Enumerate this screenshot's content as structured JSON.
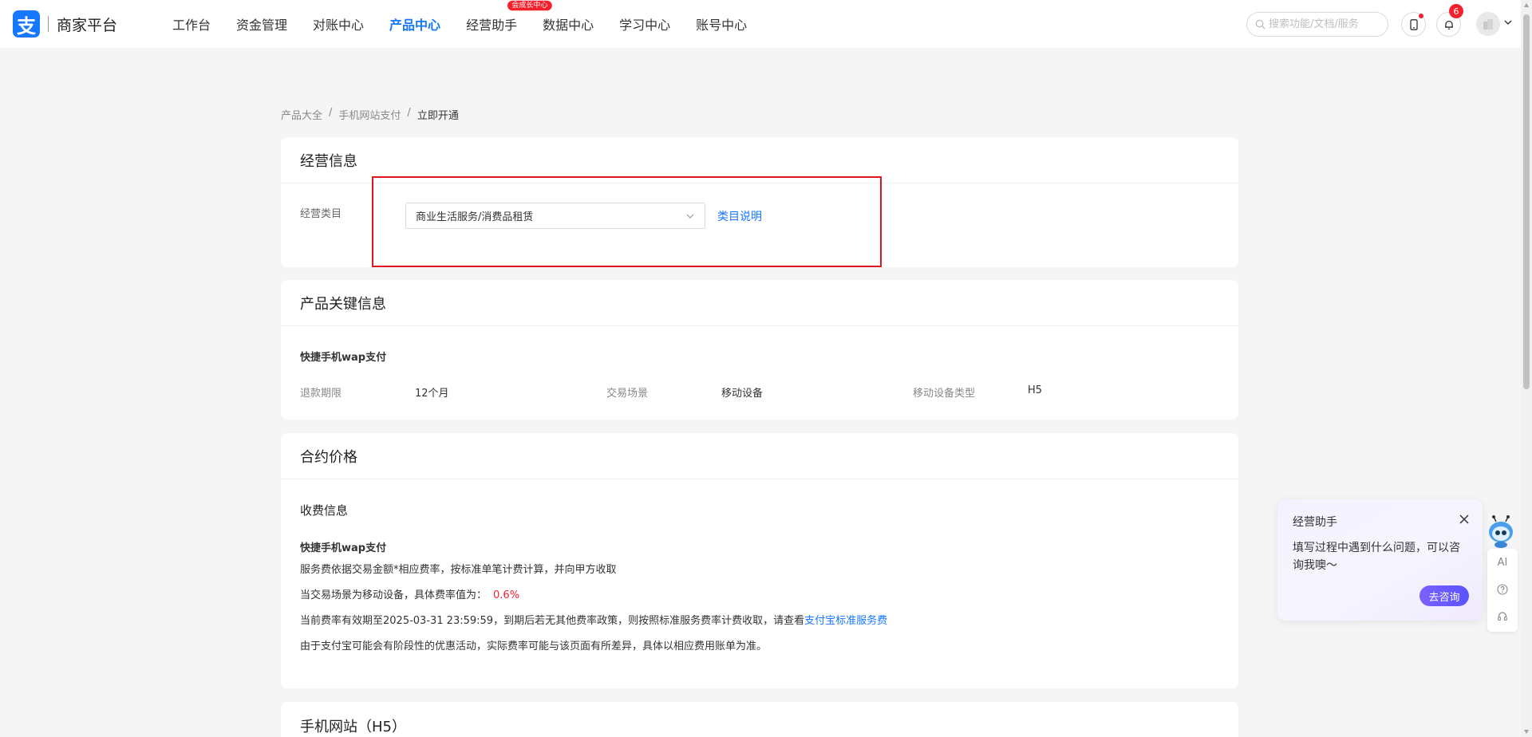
{
  "header": {
    "logo_glyph": "支",
    "app_title": "商家平台",
    "nav": [
      {
        "label": "工作台",
        "active": false
      },
      {
        "label": "资金管理",
        "active": false
      },
      {
        "label": "对账中心",
        "active": false
      },
      {
        "label": "产品中心",
        "active": true
      },
      {
        "label": "经营助手",
        "active": false,
        "badge": "会成长中心"
      },
      {
        "label": "数据中心",
        "active": false
      },
      {
        "label": "学习中心",
        "active": false
      },
      {
        "label": "账号中心",
        "active": false
      }
    ],
    "search_placeholder": "搜索功能/文档/服务",
    "notification_count": "6",
    "accent_color": "#1677ff"
  },
  "breadcrumb": {
    "items": [
      "产品大全",
      "手机网站支付"
    ],
    "separator": "/",
    "current": "立即开通"
  },
  "business_info": {
    "title": "经营信息",
    "category_label": "经营类目",
    "category_value": "商业生活服务/消费品租赁",
    "category_link": "类目说明"
  },
  "product_key_info": {
    "title": "产品关键信息",
    "product_name": "快捷手机wap支付",
    "refund_label": "退款期限",
    "refund_value": "12个月",
    "scene_label": "交易场景",
    "scene_value": "移动设备",
    "device_type_label": "移动设备类型",
    "device_type_value": "H5"
  },
  "contract_price": {
    "title": "合约价格",
    "fee_section_title": "收费信息",
    "product_name": "快捷手机wap支付",
    "line1": "服务费依据交易金额*相应费率，按标准单笔计费计算，并向甲方收取",
    "line2_prefix": "当交易场景为移动设备，具体费率值为：",
    "rate": "0.6%",
    "line3_prefix": "当前费率有效期至2025-03-31 23:59:59，到期后若无其他费率政策，则按照标准服务费率计费收取，请查看",
    "line3_link": "支付宝标准服务费",
    "line4": "由于支付宝可能会有阶段性的优惠活动，实际费率可能与该页面有所差异，具体以相应费用账单为准。",
    "rate_color": "#f5222d"
  },
  "h5_card": {
    "title": "手机网站（H5）"
  },
  "assistant": {
    "title": "经营助手",
    "message": "填写过程中遇到什么问题，可以咨询我噢～",
    "button": "去咨询",
    "tools": [
      "AI"
    ]
  }
}
